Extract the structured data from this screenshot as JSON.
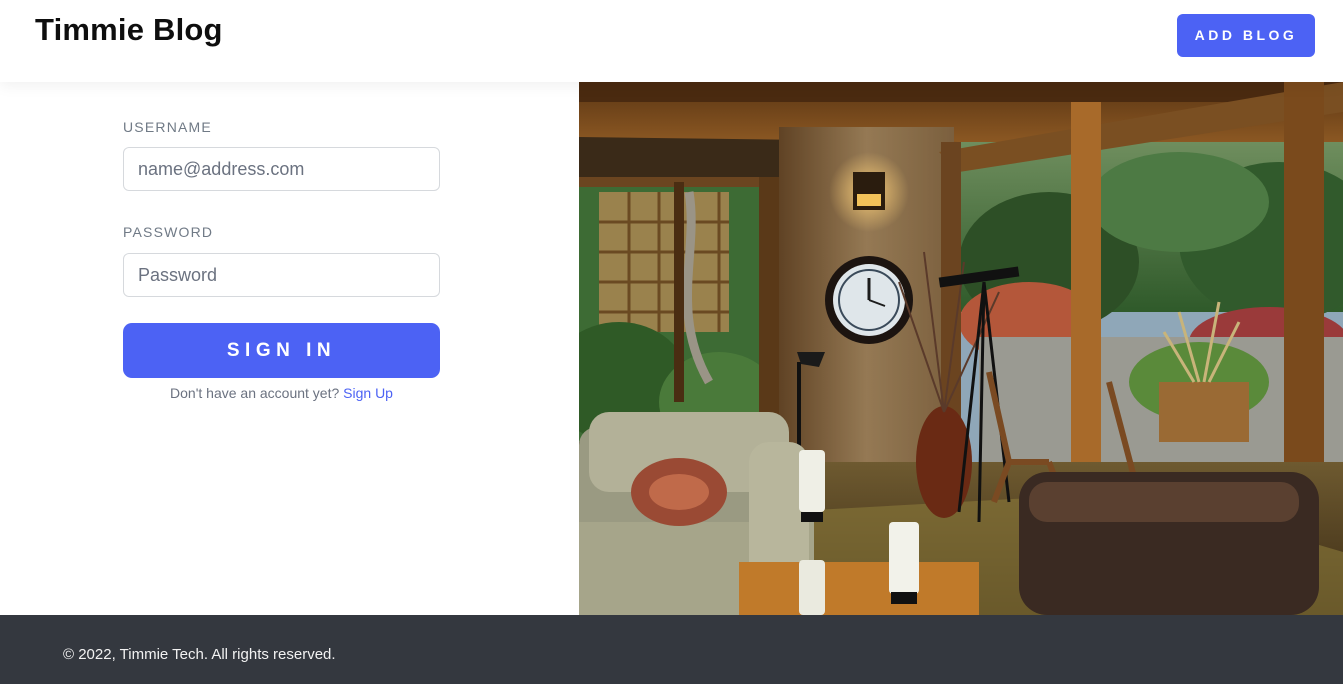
{
  "header": {
    "brand": "Timmie Blog",
    "add_blog_label": "ADD BLOG"
  },
  "login_form": {
    "username_label": "USERNAME",
    "username_placeholder": "name@address.com",
    "username_value": "",
    "password_label": "PASSWORD",
    "password_placeholder": "Password",
    "password_value": "",
    "submit_label": "SIGN IN",
    "signup_prompt": "Don't have an account yet?",
    "signup_link": "Sign Up"
  },
  "footer": {
    "copyright": "© 2022, Timmie Tech. All rights reserved."
  },
  "colors": {
    "accent": "#4c62f4",
    "footer_bg": "#34383f",
    "label": "#707a86"
  }
}
